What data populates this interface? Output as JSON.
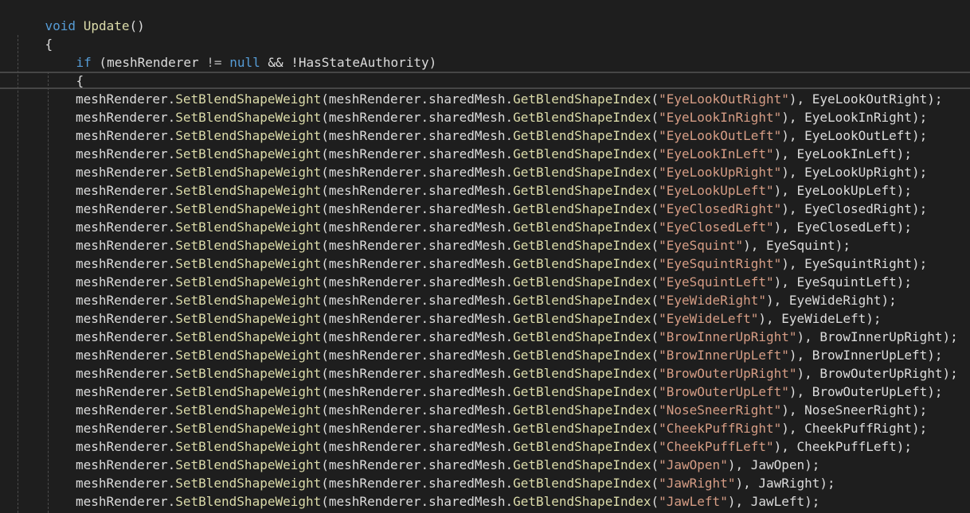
{
  "editor": {
    "line_1": {
      "kw": "void",
      "name": "Update",
      "rest": "()"
    },
    "line_2": {
      "brace": "{"
    },
    "line_3": {
      "kw": "if",
      "open": " (",
      "var": "meshRenderer",
      "neq": " != ",
      "nullkw": "null",
      "rest": " && !HasStateAuthority)"
    },
    "line_4": {
      "brace": "{"
    },
    "call_parts": {
      "obj": "meshRenderer.",
      "method": "SetBlendShapeWeight",
      "arg_pre": "(meshRenderer.sharedMesh.",
      "index_method": "GetBlendShapeIndex",
      "paren": "(",
      "close_pre": "), ",
      "end": ");"
    },
    "blend_shapes": [
      "EyeLookOutRight",
      "EyeLookInRight",
      "EyeLookOutLeft",
      "EyeLookInLeft",
      "EyeLookUpRight",
      "EyeLookUpLeft",
      "EyeClosedRight",
      "EyeClosedLeft",
      "EyeSquint",
      "EyeSquintRight",
      "EyeSquintLeft",
      "EyeWideRight",
      "EyeWideLeft",
      "BrowInnerUpRight",
      "BrowInnerUpLeft",
      "BrowOuterUpRight",
      "BrowOuterUpLeft",
      "NoseSneerRight",
      "CheekPuffRight",
      "CheekPuffLeft",
      "JawOpen",
      "JawRight",
      "JawLeft"
    ],
    "colors": {
      "background": "#1e1e1e",
      "keyword": "#569cd6",
      "method": "#dcdcaa",
      "string": "#d69d85",
      "text": "#dcdcdc"
    }
  }
}
